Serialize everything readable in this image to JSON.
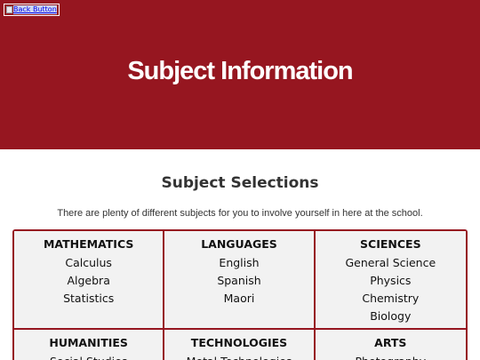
{
  "header": {
    "back_button_label": "Back Button",
    "title": "Subject Information"
  },
  "main": {
    "section_title": "Subject Selections",
    "intro": "There are plenty of different subjects for you to involve yourself in here at the school.",
    "categories": [
      {
        "name": "MATHEMATICS",
        "items": [
          "Calculus",
          "Algebra",
          "Statistics"
        ]
      },
      {
        "name": "LANGUAGES",
        "items": [
          "English",
          "Spanish",
          "Maori"
        ]
      },
      {
        "name": "SCIENCES",
        "items": [
          "General Science",
          "Physics",
          "Chemistry",
          "Biology"
        ]
      },
      {
        "name": "HUMANITIES",
        "items": [
          "Social Studies"
        ]
      },
      {
        "name": "TECHNOLOGIES",
        "items": [
          "Metal Technologies"
        ]
      },
      {
        "name": "ARTS",
        "items": [
          "Photography"
        ]
      }
    ]
  },
  "colors": {
    "brand_red": "#961620",
    "cell_background": "#f2f2f2"
  }
}
